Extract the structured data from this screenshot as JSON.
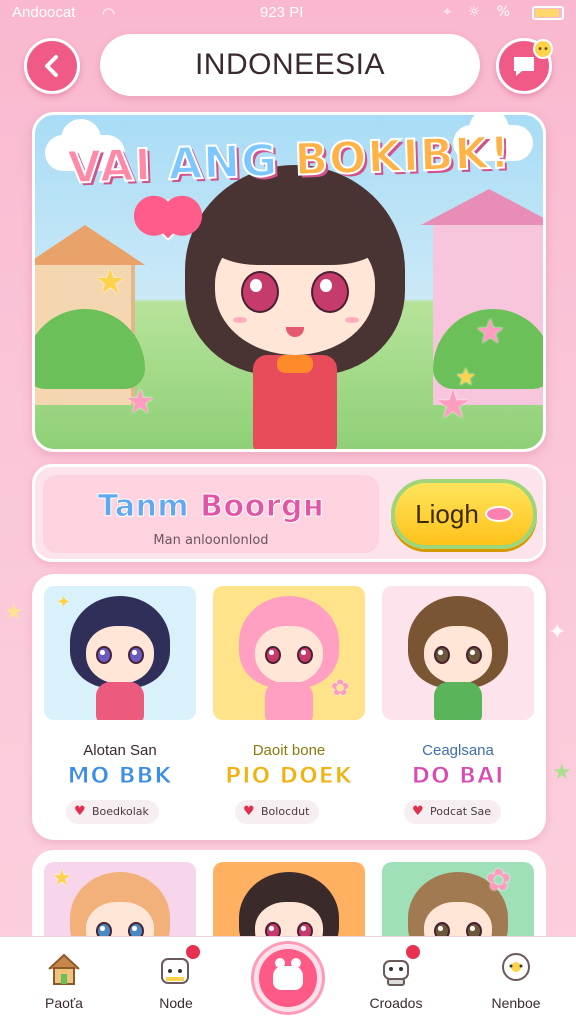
{
  "status_bar": {
    "carrier": "Andoocat",
    "time": "923 PI",
    "icons": "⌖ ☼ %"
  },
  "header": {
    "title": "INDONEESIA",
    "back_icon": "chevron-left-icon",
    "message_icon": "chat-bubble-icon"
  },
  "hero": {
    "title_parts": [
      "VAI",
      "ANG",
      "BOKIBK!"
    ],
    "colors": {
      "hair": "#4a3433",
      "eyes": "#c43b6c",
      "dress": "#e84c5b",
      "bow": "#ff8a2a"
    }
  },
  "banner": {
    "title_a": "Tanm",
    "title_b": "Boorgн",
    "subtitle": "Man anloonlonlod",
    "login_label": "Liogh"
  },
  "cards": [
    {
      "name": "Alotan San",
      "tag": "MO BBK",
      "like_label": "Boedkolak",
      "tag_color": "#3b8ee8",
      "bg": "#d8f1fb",
      "hair": "#2f2f5a",
      "outfit": "#ec5a7e"
    },
    {
      "name": "Daoit bone",
      "tag": "PIO DOEK",
      "like_label": "Bolocdut",
      "tag_color": "#f1b20f",
      "bg": "#ffe38a",
      "hair": "#ff9fc2",
      "outfit": "#ff9fc2"
    },
    {
      "name": "Ceaglsana",
      "tag": "DO BAI",
      "like_label": "Podcat Sae",
      "tag_color": "#d84bb3",
      "bg": "#fde3ec",
      "hair": "#7a5533",
      "outfit": "#5ab55a"
    }
  ],
  "cards_row2": [
    {
      "bg": "#f7d6ec",
      "hair": "#f2b07a"
    },
    {
      "bg": "#ffb061",
      "hair": "#3b2a2a"
    },
    {
      "bg": "#9fe0b8",
      "hair": "#a27a52"
    }
  ],
  "nav": {
    "items": [
      {
        "label": "Paoťa",
        "icon": "house-icon"
      },
      {
        "label": "Node",
        "icon": "cat-icon"
      },
      {
        "label": "Croados",
        "icon": "robot-icon"
      },
      {
        "label": "Nenboe",
        "icon": "flower-icon"
      }
    ],
    "center_icon": "paw-icon"
  }
}
